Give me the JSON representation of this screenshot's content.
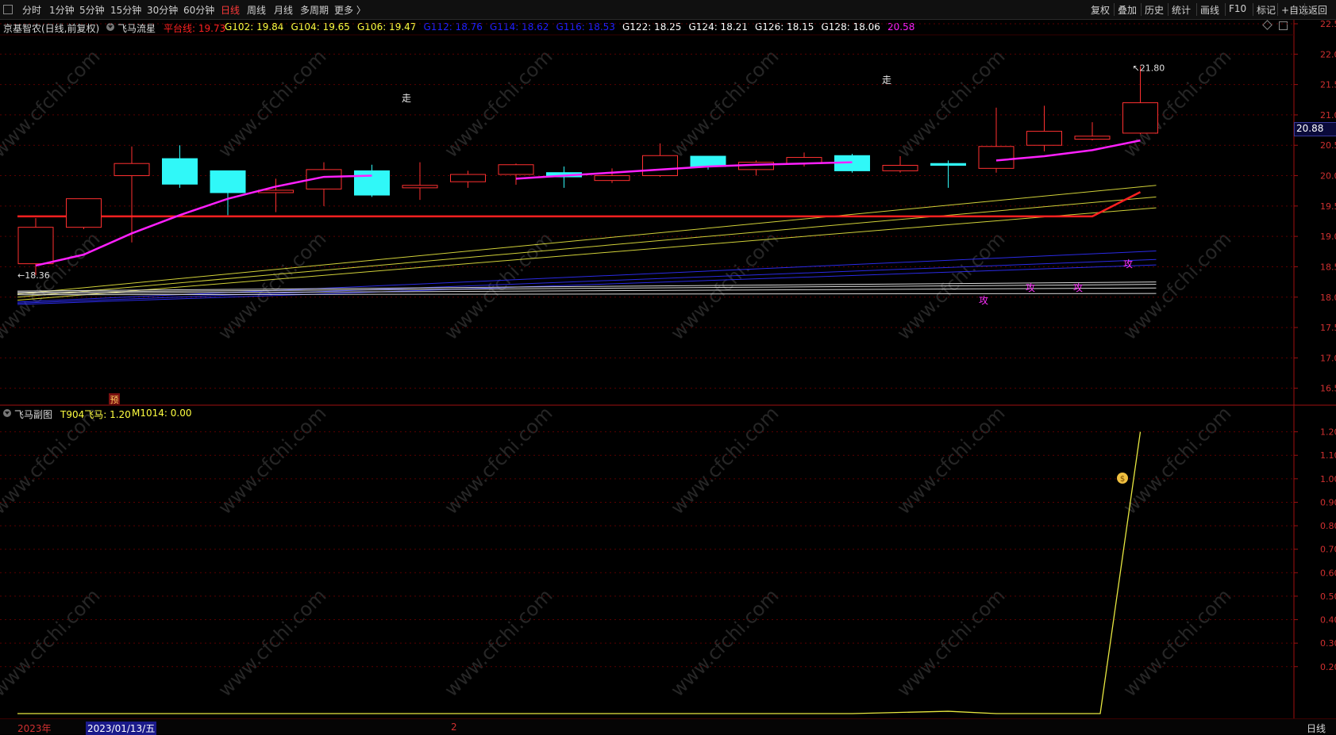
{
  "toolbar": {
    "periods": [
      "分时",
      "1分钟",
      "5分钟",
      "15分钟",
      "30分钟",
      "60分钟",
      "日线",
      "周线",
      "月线",
      "多周期",
      "更多 〉"
    ],
    "active_period": "日线",
    "right_buttons": [
      "复权",
      "叠加",
      "历史",
      "统计",
      "画线",
      "F10",
      "标记",
      "+自选",
      "返回"
    ]
  },
  "main": {
    "stock_label": "京基智农(日线,前复权)",
    "indicator_name": "飞马流星",
    "values": [
      {
        "label": "平台线: 19.73",
        "color": "#ff2020"
      },
      {
        "label": "G102: 19.84",
        "color": "#ffff40"
      },
      {
        "label": "G104: 19.65",
        "color": "#ffff40"
      },
      {
        "label": "G106: 19.47",
        "color": "#ffff40"
      },
      {
        "label": "G112: 18.76",
        "color": "#2020ff"
      },
      {
        "label": "G114: 18.62",
        "color": "#2020ff"
      },
      {
        "label": "G116: 18.53",
        "color": "#2020ff"
      },
      {
        "label": "G122: 18.25",
        "color": "#ffffff"
      },
      {
        "label": "G124: 18.21",
        "color": "#ffffff"
      },
      {
        "label": "G126: 18.15",
        "color": "#ffffff"
      },
      {
        "label": "G128: 18.06",
        "color": "#ffffff"
      },
      {
        "label": "20.58",
        "color": "#ff20ff"
      }
    ],
    "current_price": "20.88",
    "high_label": "21.80",
    "low_label": "←18.36",
    "signal_zou": "走",
    "signal_gong": "攻",
    "signal_yu": "预"
  },
  "sub": {
    "name": "飞马副图",
    "values": [
      {
        "label": "T904飞马: 1.20",
        "color": "#ffff40"
      },
      {
        "label": "M1014: 0.00",
        "color": "#ffff40"
      }
    ]
  },
  "bottom": {
    "year": "2023年",
    "cursor_date": "2023/01/13/五",
    "mark": "2",
    "period": "日线"
  },
  "watermark": "www.cfchi.com",
  "chart_data": [
    {
      "type": "candlestick",
      "title": "",
      "ylim": [
        16.3,
        22.5
      ],
      "yticks": [
        16.5,
        17.0,
        17.5,
        18.0,
        18.5,
        19.0,
        19.5,
        20.0,
        20.5,
        21.0,
        21.5,
        22.0,
        22.5
      ],
      "grid": true,
      "candles": [
        {
          "o": 18.55,
          "c": 19.15,
          "h": 19.3,
          "l": 18.36,
          "color": "red"
        },
        {
          "o": 19.15,
          "c": 19.62,
          "h": 19.62,
          "l": 19.12,
          "color": "red"
        },
        {
          "o": 20.0,
          "c": 20.2,
          "h": 20.48,
          "l": 18.9,
          "color": "red"
        },
        {
          "o": 20.28,
          "c": 19.86,
          "h": 20.5,
          "l": 19.8,
          "color": "cyan"
        },
        {
          "o": 20.08,
          "c": 19.72,
          "h": 20.08,
          "l": 19.35,
          "color": "cyan"
        },
        {
          "o": 19.72,
          "c": 19.76,
          "h": 19.95,
          "l": 19.4,
          "color": "red"
        },
        {
          "o": 19.78,
          "c": 20.1,
          "h": 20.22,
          "l": 19.5,
          "color": "red"
        },
        {
          "o": 20.08,
          "c": 19.68,
          "h": 20.18,
          "l": 19.65,
          "color": "cyan"
        },
        {
          "o": 19.8,
          "c": 19.84,
          "h": 20.22,
          "l": 19.6,
          "color": "red"
        },
        {
          "o": 19.9,
          "c": 20.02,
          "h": 20.08,
          "l": 19.8,
          "color": "red"
        },
        {
          "o": 20.02,
          "c": 20.18,
          "h": 20.2,
          "l": 19.85,
          "color": "red"
        },
        {
          "o": 20.05,
          "c": 19.98,
          "h": 20.15,
          "l": 19.8,
          "color": "cyan"
        },
        {
          "o": 19.92,
          "c": 20.0,
          "h": 20.12,
          "l": 19.88,
          "color": "red"
        },
        {
          "o": 20.0,
          "c": 20.33,
          "h": 20.53,
          "l": 19.98,
          "color": "red"
        },
        {
          "o": 20.32,
          "c": 20.15,
          "h": 20.32,
          "l": 20.1,
          "color": "cyan"
        },
        {
          "o": 20.1,
          "c": 20.22,
          "h": 20.25,
          "l": 20.0,
          "color": "red"
        },
        {
          "o": 20.2,
          "c": 20.3,
          "h": 20.38,
          "l": 20.15,
          "color": "red"
        },
        {
          "o": 20.33,
          "c": 20.08,
          "h": 20.36,
          "l": 20.05,
          "color": "cyan"
        },
        {
          "o": 20.08,
          "c": 20.17,
          "h": 20.32,
          "l": 20.05,
          "color": "red"
        },
        {
          "o": 20.2,
          "c": 20.17,
          "h": 20.25,
          "l": 19.8,
          "color": "cyan"
        },
        {
          "o": 20.12,
          "c": 20.48,
          "h": 21.12,
          "l": 20.05,
          "color": "red"
        },
        {
          "o": 20.5,
          "c": 20.73,
          "h": 21.15,
          "l": 20.4,
          "color": "red"
        },
        {
          "o": 20.6,
          "c": 20.65,
          "h": 20.88,
          "l": 20.58,
          "color": "red"
        },
        {
          "o": 20.7,
          "c": 21.2,
          "h": 21.8,
          "l": 20.68,
          "color": "red"
        }
      ],
      "series": [
        {
          "name": "平台线",
          "color": "#ff2020",
          "start": 0,
          "values": [
            19.33,
            19.33,
            19.33,
            19.33,
            19.33,
            19.33,
            19.33,
            19.33,
            19.33,
            19.33,
            19.33,
            19.33,
            19.33,
            19.33,
            19.33,
            19.33,
            19.33,
            19.33,
            19.33,
            19.33,
            19.33,
            19.33,
            19.33,
            19.73
          ]
        },
        {
          "name": "20.58",
          "color": "#ff20ff",
          "segments": [
            {
              "start": 0,
              "values": [
                18.52,
                18.7,
                19.05,
                19.35,
                19.62,
                19.82,
                19.98,
                20.0
              ]
            },
            {
              "start": 10,
              "values": [
                19.95,
                20.0,
                20.05,
                20.1,
                20.15,
                20.18,
                20.2,
                20.22
              ]
            },
            {
              "start": 20,
              "values": [
                20.25,
                20.32,
                20.42,
                20.58
              ]
            }
          ]
        },
        {
          "name": "G102",
          "color": "#e8e840",
          "endpoints": [
            18.05,
            19.84
          ]
        },
        {
          "name": "G104",
          "color": "#e8e840",
          "endpoints": [
            18.0,
            19.65
          ]
        },
        {
          "name": "G106",
          "color": "#e8e840",
          "endpoints": [
            17.95,
            19.47
          ]
        },
        {
          "name": "G112",
          "color": "#3030ff",
          "endpoints": [
            17.92,
            18.76
          ]
        },
        {
          "name": "G114",
          "color": "#3030ff",
          "endpoints": [
            17.9,
            18.62
          ]
        },
        {
          "name": "G116",
          "color": "#3030ff",
          "endpoints": [
            17.88,
            18.53
          ]
        },
        {
          "name": "G122",
          "color": "#f0f0f0",
          "endpoints": [
            18.1,
            18.25
          ]
        },
        {
          "name": "G124",
          "color": "#f0f0f0",
          "endpoints": [
            18.08,
            18.21
          ]
        },
        {
          "name": "G126",
          "color": "#f0f0f0",
          "endpoints": [
            18.06,
            18.15
          ]
        },
        {
          "name": "G128",
          "color": "#f0f0f0",
          "endpoints": [
            18.04,
            18.06
          ]
        }
      ]
    },
    {
      "type": "line",
      "title": "",
      "ylim": [
        0,
        1.3
      ],
      "yticks": [
        0.2,
        0.3,
        0.4,
        0.5,
        0.6,
        0.7,
        0.8,
        0.9,
        1.0,
        1.1,
        1.2
      ],
      "grid": true,
      "series": [
        {
          "name": "T904飞马",
          "color": "#e8e840",
          "values": [
            0,
            0,
            0,
            0,
            0,
            0,
            0,
            0,
            0,
            0,
            0,
            0,
            0,
            0,
            0,
            0,
            0,
            0,
            0.005,
            0.01,
            0,
            0,
            0,
            1.2
          ]
        }
      ]
    }
  ]
}
